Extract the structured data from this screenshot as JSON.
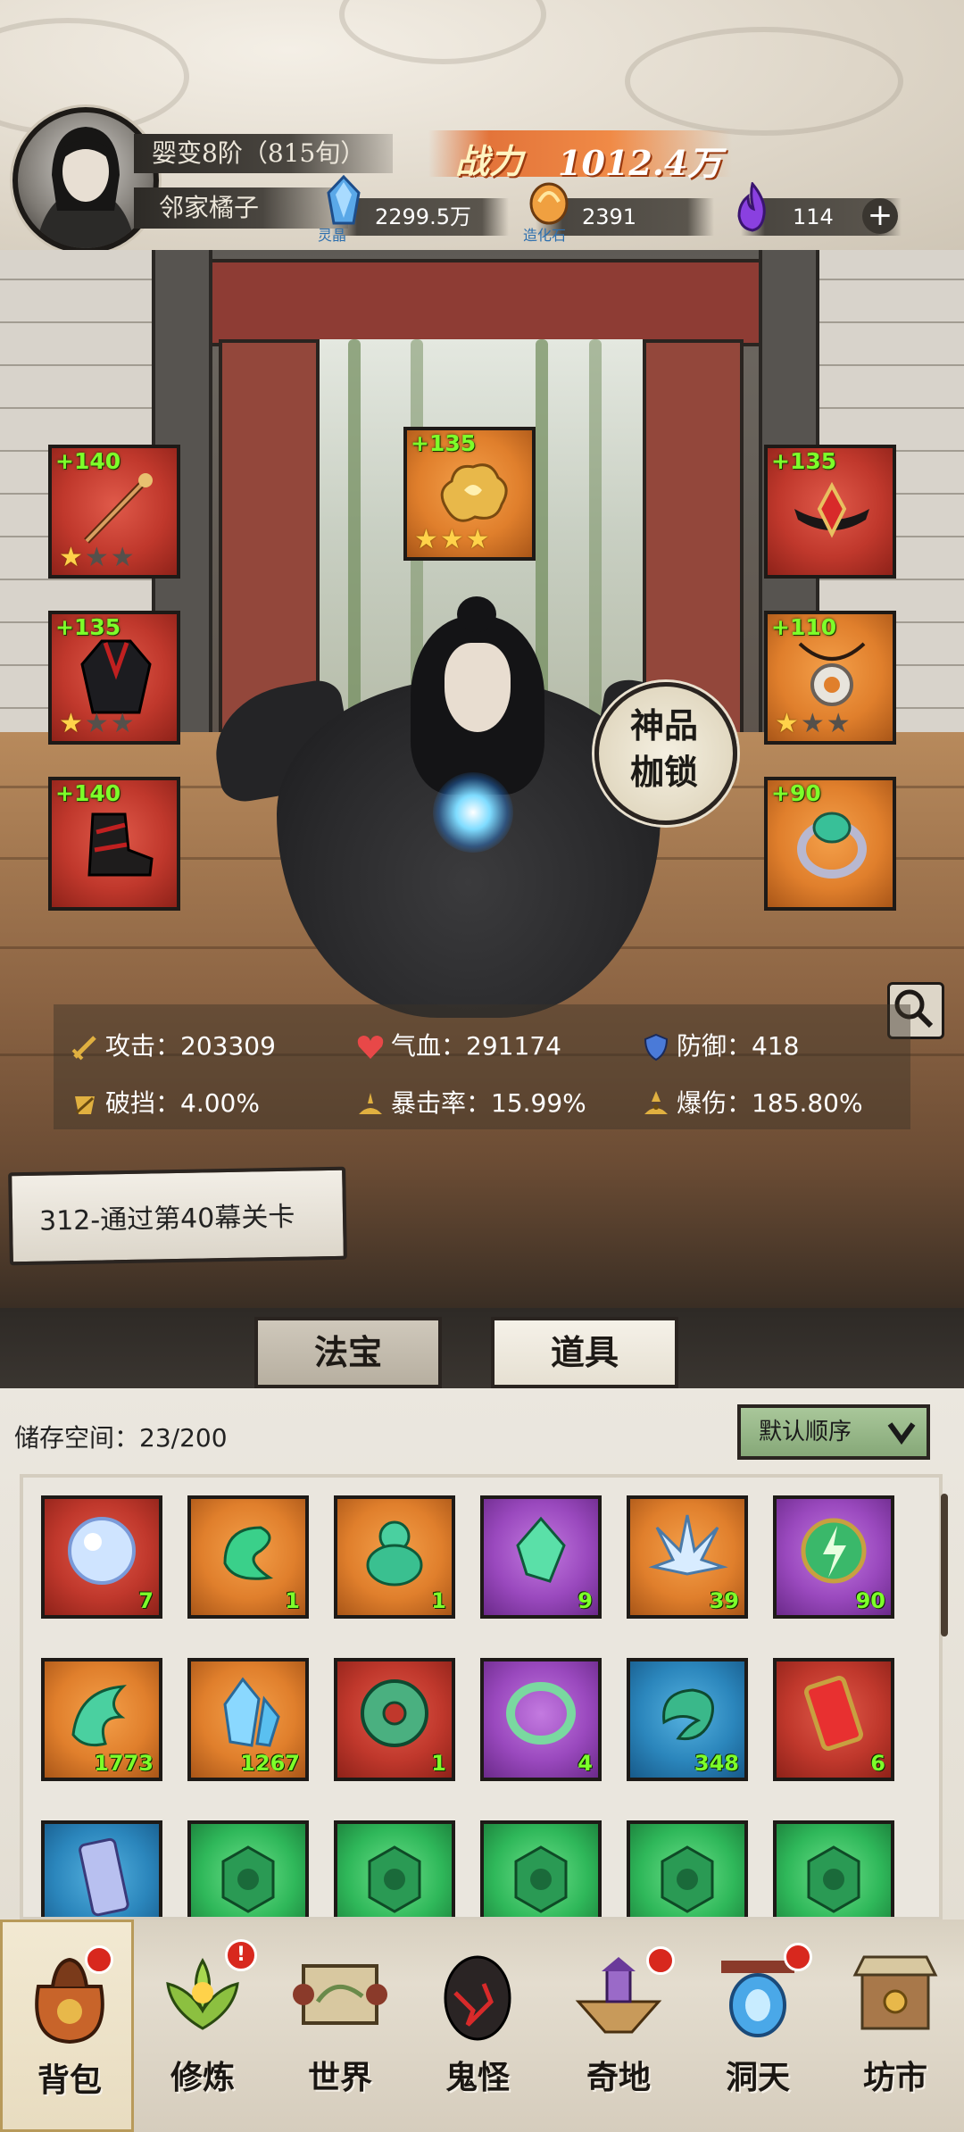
{
  "header": {
    "realm": "婴变8阶（815旬）",
    "name": "邻家橘子",
    "power_label": "战力",
    "power_value": "1012.4万",
    "resources": [
      {
        "id": "lingjing",
        "icon": "blue-crystal-icon",
        "caption": "灵晶",
        "value": "2299.5万"
      },
      {
        "id": "zaohuashi",
        "icon": "creation-stone-icon",
        "caption": "造化石",
        "value": "2391"
      },
      {
        "id": "soul",
        "icon": "purple-flame-icon",
        "caption": "",
        "value": "114"
      }
    ],
    "add_symbol": "+"
  },
  "equipment": {
    "left": [
      {
        "level": "+140",
        "stars": 1,
        "color": "red",
        "icon": "staff-icon"
      },
      {
        "level": "+135",
        "stars": 1,
        "color": "red",
        "icon": "robe-icon"
      },
      {
        "level": "+140",
        "stars": 0,
        "color": "red",
        "icon": "boots-icon"
      }
    ],
    "top": {
      "level": "+135",
      "stars": 3,
      "color": "orange",
      "icon": "golden-cloud-icon"
    },
    "right": [
      {
        "level": "+135",
        "stars": 0,
        "color": "red",
        "icon": "headband-icon"
      },
      {
        "level": "+110",
        "stars": 1,
        "color": "orange",
        "icon": "pendant-icon"
      },
      {
        "level": "+90",
        "stars": 0,
        "color": "orange",
        "icon": "ring-icon"
      }
    ]
  },
  "badge": "神品枷锁",
  "stats": [
    {
      "icon": "sword-icon",
      "label": "攻击：203309",
      "color": "#e0b040"
    },
    {
      "icon": "heart-icon",
      "label": "气血：291174",
      "color": "#e84848"
    },
    {
      "icon": "shield-icon",
      "label": "防御：418",
      "color": "#4a7ad8"
    },
    {
      "icon": "break-block-icon",
      "label": "破挡：4.00%",
      "color": "#e0b040"
    },
    {
      "icon": "crit-rate-icon",
      "label": "暴击率：15.99%",
      "color": "#e0b040"
    },
    {
      "icon": "crit-damage-icon",
      "label": "爆伤：185.80%",
      "color": "#e0b040"
    }
  ],
  "quest": "312-通过第40幕关卡",
  "tabs": [
    "法宝",
    "道具"
  ],
  "inventory": {
    "storage_label": "储存空间：23/200",
    "sort_label": "默认顺序",
    "items": [
      {
        "color": "red",
        "icon": "crystal-orb-icon",
        "qty": "7"
      },
      {
        "color": "orange",
        "icon": "green-wind-icon",
        "qty": "1"
      },
      {
        "color": "orange",
        "icon": "jade-gourd-icon",
        "qty": "1"
      },
      {
        "color": "purple",
        "icon": "green-crystal-icon",
        "qty": "9"
      },
      {
        "color": "orange",
        "icon": "ice-crystal-icon",
        "qty": "39"
      },
      {
        "color": "purple",
        "icon": "thunder-orb-icon",
        "qty": "90"
      },
      {
        "color": "orange",
        "icon": "green-wave-icon",
        "qty": "1773"
      },
      {
        "color": "orange",
        "icon": "blue-crystal-cluster-icon",
        "qty": "1267"
      },
      {
        "color": "red",
        "icon": "jade-disc-icon",
        "qty": "1"
      },
      {
        "color": "purple",
        "icon": "jade-ring-icon",
        "qty": "4"
      },
      {
        "color": "blue",
        "icon": "jade-dragon-icon",
        "qty": "348"
      },
      {
        "color": "red",
        "icon": "talisman-icon",
        "qty": "6"
      },
      {
        "color": "blue",
        "icon": "scroll-icon",
        "qty": ""
      },
      {
        "color": "green",
        "icon": "green-token-icon",
        "qty": ""
      },
      {
        "color": "green",
        "icon": "green-token-icon",
        "qty": ""
      },
      {
        "color": "green",
        "icon": "green-token-icon",
        "qty": ""
      },
      {
        "color": "green",
        "icon": "green-token-icon",
        "qty": ""
      },
      {
        "color": "green",
        "icon": "green-token-icon",
        "qty": ""
      }
    ]
  },
  "nav": [
    {
      "label": "背包",
      "icon": "bag-icon",
      "dot": true
    },
    {
      "label": "修炼",
      "icon": "lotus-icon",
      "badge": "!"
    },
    {
      "label": "世界",
      "icon": "world-scroll-icon"
    },
    {
      "label": "鬼怪",
      "icon": "demon-egg-icon"
    },
    {
      "label": "奇地",
      "icon": "floating-island-icon",
      "dot": true
    },
    {
      "label": "洞天",
      "icon": "portal-icon",
      "dot": true
    },
    {
      "label": "坊市",
      "icon": "market-stall-icon"
    }
  ]
}
